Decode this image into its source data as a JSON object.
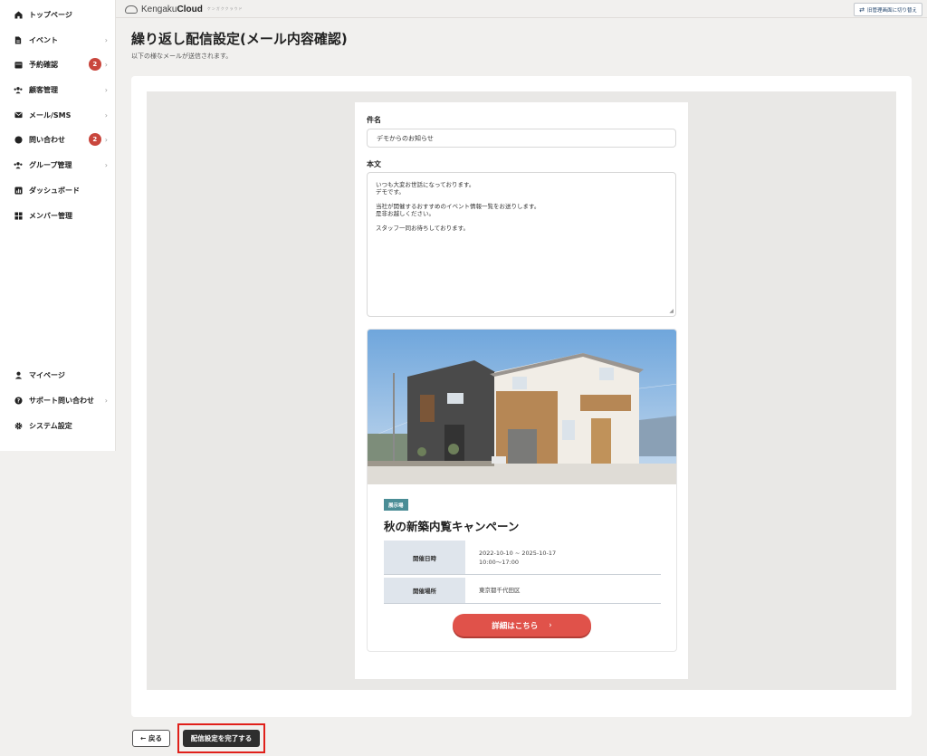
{
  "sidebar": {
    "main_items": [
      {
        "label": "トップページ",
        "icon": "home-icon",
        "chevron": false
      },
      {
        "label": "イベント",
        "icon": "document-icon",
        "chevron": true
      },
      {
        "label": "予約確認",
        "icon": "calendar-icon",
        "chevron": true,
        "badge": "2"
      },
      {
        "label": "顧客管理",
        "icon": "users-icon",
        "chevron": true
      },
      {
        "label": "メール/SMS",
        "icon": "mail-icon",
        "chevron": true
      },
      {
        "label": "問い合わせ",
        "icon": "chat-icon",
        "chevron": true,
        "badge": "2"
      },
      {
        "label": "グループ管理",
        "icon": "group-icon",
        "chevron": true
      },
      {
        "label": "ダッシュボード",
        "icon": "chart-icon",
        "chevron": false
      },
      {
        "label": "メンバー管理",
        "icon": "grid-icon",
        "chevron": false
      }
    ],
    "bottom_items": [
      {
        "label": "マイページ",
        "icon": "person-icon",
        "chevron": false
      },
      {
        "label": "サポート問い合わせ",
        "icon": "help-icon",
        "chevron": true
      },
      {
        "label": "システム設定",
        "icon": "gear-icon",
        "chevron": false
      }
    ]
  },
  "header": {
    "brand_light": "Kengaku",
    "brand_bold": "Cloud",
    "brand_tagline": "ケンガククラウド",
    "switch_label": "旧管理画面に切り替え"
  },
  "page": {
    "title": "繰り返し配信設定(メール内容確認)",
    "subtitle": "以下の様なメールが送信されます。"
  },
  "mail": {
    "subject_label": "件名",
    "subject_value": "デモからのお知らせ",
    "body_label": "本文",
    "body_lines": [
      "いつも大変お世話になっております。",
      "デモです。",
      "",
      "当社が開催するおすすめのイベント情報一覧をお送りします。",
      "是非お越しください。",
      "",
      "スタッフ一同お待ちしております。"
    ]
  },
  "event": {
    "category": "展示場",
    "title": "秋の新築内覧キャンペーン",
    "rows": [
      {
        "label": "開催日時",
        "lines": [
          "2022-10-10 ~ 2025-10-17",
          "10:00〜17:00"
        ]
      },
      {
        "label": "開催場所",
        "lines": [
          "東京都千代田区"
        ]
      }
    ],
    "detail_button": "詳細はこちら"
  },
  "actions": {
    "back_label": "← 戻る",
    "complete_label": "配信設定を完了する"
  },
  "colors": {
    "accent_red": "#e0524a",
    "badge_red": "#c9463d",
    "tag_teal": "#4a8d96",
    "highlight_border": "#e0201a"
  }
}
